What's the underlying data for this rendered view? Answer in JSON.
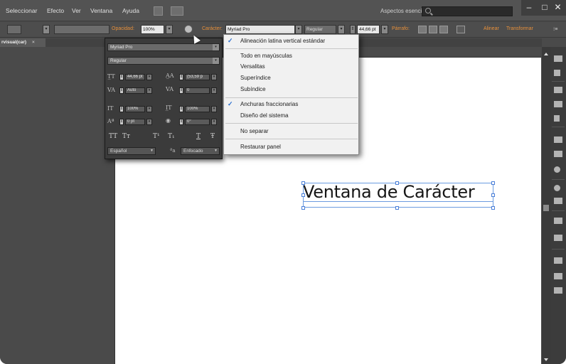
{
  "menubar": {
    "items": [
      "Seleccionar",
      "Efecto",
      "Ver",
      "Ventana",
      "Ayuda"
    ],
    "workspace": "Aspectos esenciales",
    "window_buttons": {
      "minimize": "–",
      "maximize": "□",
      "close": "✕"
    }
  },
  "controlbar": {
    "opacity_label": "Opacidad:",
    "opacity_value": "100%",
    "character_label": "Carácter:",
    "font_family": "Myriad Pro",
    "font_style": "Regular",
    "font_size": "44,66 pt",
    "paragraph_label": "Párrafo:",
    "align_label": "Alinear",
    "transform_label": "Transformar"
  },
  "document": {
    "tab_label": "rvisual(car)",
    "tab_close": "×"
  },
  "canvas": {
    "sample_text": "Ventana de Carácter"
  },
  "character_panel": {
    "font_family": "Myriad Pro",
    "font_style": "Regular",
    "font_size": "44,66 pt",
    "leading": "(53,59 p",
    "kerning": "Auto",
    "tracking": "0",
    "vertical_scale": "100%",
    "horizontal_scale": "100%",
    "baseline_shift": "0 pt",
    "rotation": "0°",
    "typo_buttons": [
      "TT",
      "Tт",
      "T¹",
      "T₁",
      "T",
      "Ŧ"
    ],
    "language": "Español",
    "aa_label": "ªa",
    "antialias": "Enfocado"
  },
  "flyout_menu": {
    "groups": [
      [
        {
          "label": "Alineación latina vertical estándar",
          "checked": true
        }
      ],
      [
        {
          "label": "Todo en mayúsculas",
          "checked": false
        },
        {
          "label": "Versalitas",
          "checked": false
        },
        {
          "label": "Superíndice",
          "checked": false
        },
        {
          "label": "Subíndice",
          "checked": false
        }
      ],
      [
        {
          "label": "Anchuras fraccionarias",
          "checked": true
        },
        {
          "label": "Diseño del sistema",
          "checked": false
        }
      ],
      [
        {
          "label": "No separar",
          "checked": false
        }
      ],
      [
        {
          "label": "Restaurar panel",
          "checked": false
        }
      ]
    ],
    "check_glyph": "✓"
  },
  "colors": {
    "accent_orange": "#e8903a",
    "selection_blue": "#4a7fd8",
    "check_blue": "#2a6fd0"
  }
}
